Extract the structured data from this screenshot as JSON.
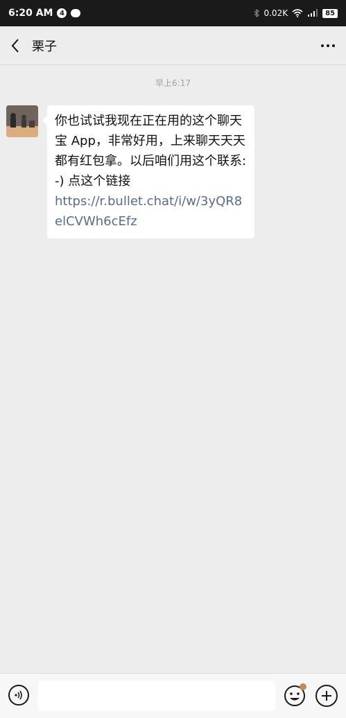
{
  "status_bar": {
    "time": "6:20 AM",
    "notification_count": "4",
    "network_speed": "0.02K",
    "battery": "85"
  },
  "header": {
    "title": "栗子"
  },
  "chat": {
    "timestamp": "早上6:17",
    "message_text": "你也试试我现在正在用的这个聊天宝 App，非常好用，上来聊天天天都有红包拿。以后咱们用这个联系:-) 点这个链接",
    "message_link": "https://r.bullet.chat/i/w/3yQR8elCVWh6cEfz"
  },
  "input_bar": {
    "placeholder": ""
  }
}
